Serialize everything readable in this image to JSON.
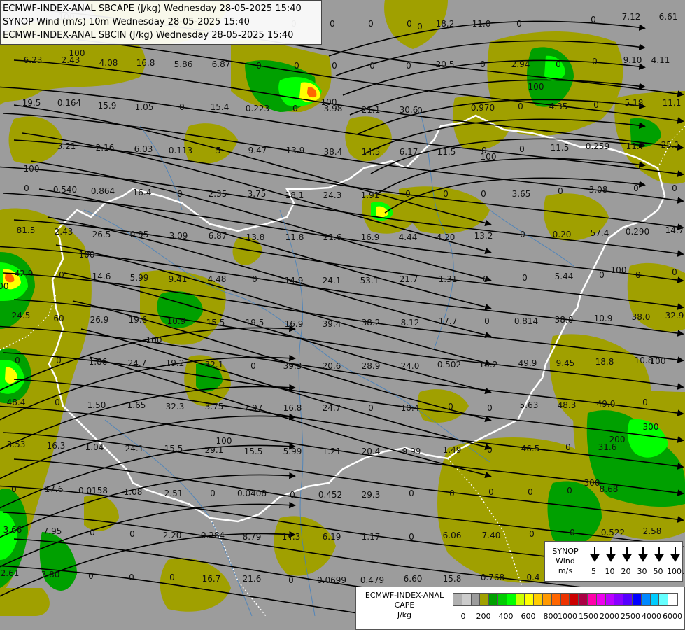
{
  "header": {
    "line1": "ECMWF-INDEX-ANAL SBCAPE (J/kg) Wednesday 28-05-2025 15:40",
    "line2": "SYNOP Wind (m/s) 10m Wednesday 28-05-2025 15:40",
    "line3": "ECMWF-INDEX-ANAL SBCIN (J/kg) Wednesday 28-05-2025 15:40"
  },
  "synop_legend": {
    "title_line1": "SYNOP",
    "title_line2": "Wind",
    "title_line3": "m/s",
    "speeds": [
      "5",
      "10",
      "20",
      "30",
      "50",
      "100"
    ]
  },
  "cape_legend": {
    "title_line1": "ECMWF-INDEX-ANAL",
    "title_line2": "CAPE",
    "title_line3": "J/kg",
    "colors": [
      "#b0b0b0",
      "#cccccc",
      "#9c9c9c",
      "#a0a000",
      "#00a000",
      "#00cc00",
      "#00ff00",
      "#ccff00",
      "#ffff00",
      "#ffcc00",
      "#ff9900",
      "#ff6600",
      "#ee3300",
      "#cc0000",
      "#aa0044",
      "#ff00aa",
      "#ee00ee",
      "#bb00ff",
      "#8800ff",
      "#5500ff",
      "#0000ff",
      "#0088ff",
      "#00ccff",
      "#66ffff",
      "#ffffff"
    ],
    "ticks": [
      "0",
      "200",
      "400",
      "600",
      "800",
      "1000",
      "1500",
      "2000",
      "2500",
      "4000",
      "6000"
    ]
  },
  "map_colors": {
    "background": "#9c9c9c",
    "cape_low": "#a0a000",
    "cape_mid": "#00a000",
    "cape_high": "#00ff00",
    "cape_peak": "#ffff00",
    "cape_max": "#ff6600",
    "border": "#ffffff",
    "river": "#4080c0",
    "streamline": "#000000"
  },
  "value_labels": [
    "0",
    "0",
    "0",
    "0",
    "0",
    "18.2",
    "11.0",
    "0",
    "0",
    "7.12",
    "6.61",
    "6.23",
    "2.43",
    "4.08",
    "16.8",
    "5.86",
    "6.87",
    "0",
    "0",
    "0",
    "0",
    "0",
    "20.5",
    "0",
    "2.94",
    "0",
    "0",
    "9.10",
    "4.11",
    "19.5",
    "0.164",
    "15.9",
    "1.05",
    "0",
    "15.4",
    "0.223",
    "0",
    "3.98",
    "21.1",
    "30.6",
    "0",
    "0.970",
    "0",
    "4.35",
    "0",
    "5.18",
    "11.1",
    "3.21",
    "2.16",
    "6.03",
    "0.113",
    "5",
    "9.47",
    "13.9",
    "38.4",
    "14.5",
    "6.17",
    "11.5",
    "0",
    "0",
    "11.5",
    "0.259",
    "11.7",
    "25.1",
    "0",
    "0.540",
    "0.864",
    "16.4",
    "0",
    "2.35",
    "3.75",
    "18.1",
    "24.3",
    "1.91",
    "0",
    "0",
    "0",
    "3.65",
    "0",
    "3.08",
    "0",
    "0",
    "81.5",
    "2.43",
    "26.5",
    "0.95",
    "3.09",
    "6.87",
    "13.8",
    "11.8",
    "21.6",
    "16.9",
    "4.44",
    "4.20",
    "13.2",
    "0",
    "0.20",
    "57.4",
    "0.290",
    "14.7",
    "42.9",
    "0",
    "14.6",
    "5.99",
    "9.41",
    "4.48",
    "0",
    "14.9",
    "24.1",
    "53.1",
    "21.7",
    "1.31",
    "0",
    "0",
    "5.44",
    "0",
    "0",
    "0",
    "24.5",
    "60",
    "26.9",
    "19.6",
    "10.9",
    "15.5",
    "19.5",
    "16.9",
    "39.4",
    "38.2",
    "8.12",
    "17.7",
    "0",
    "0.814",
    "38.0",
    "10.9",
    "38.0",
    "32.9",
    "0",
    "0",
    "1.86",
    "24.7",
    "19.2",
    "32.1",
    "0",
    "39.3",
    "20.6",
    "28.9",
    "24.0",
    "0.502",
    "10.2",
    "49.9",
    "9.45",
    "18.8",
    "10.8",
    "48.4",
    "0",
    "1.50",
    "1.65",
    "32.3",
    "3.75",
    "7.97",
    "16.8",
    "24.7",
    "0",
    "10.4",
    "0",
    "0",
    "5.63",
    "48.3",
    "49.0",
    "0",
    "3.53",
    "16.3",
    "1.04",
    "24.1",
    "15.5",
    "29.1",
    "15.5",
    "5.99",
    "1.21",
    "20.4",
    "9.99",
    "1.49",
    "0",
    "46.5",
    "0",
    "31.6",
    "0",
    "17.6",
    "0.0158",
    "1.08",
    "2.51",
    "0",
    "0.0408",
    "0",
    "0.452",
    "29.3",
    "0",
    "0",
    "0",
    "0",
    "0",
    "8.68",
    "3.66",
    "7.95",
    "0",
    "0",
    "2.20",
    "0.284",
    "8.79",
    "14.3",
    "6.19",
    "1.17",
    "0",
    "6.06",
    "7.40",
    "0",
    "0",
    "0.522",
    "2.58",
    "2.61",
    "3.80",
    "0",
    "0",
    "0",
    "16.7",
    "21.6",
    "0",
    "0.0699",
    "0.479",
    "6.60",
    "15.8",
    "0.768",
    "0.4",
    "5.99",
    "300",
    "300",
    "200",
    "300",
    "200",
    "100",
    "100",
    "100",
    "100",
    "100",
    "100",
    "100",
    "100",
    "100",
    "100",
    "100"
  ]
}
